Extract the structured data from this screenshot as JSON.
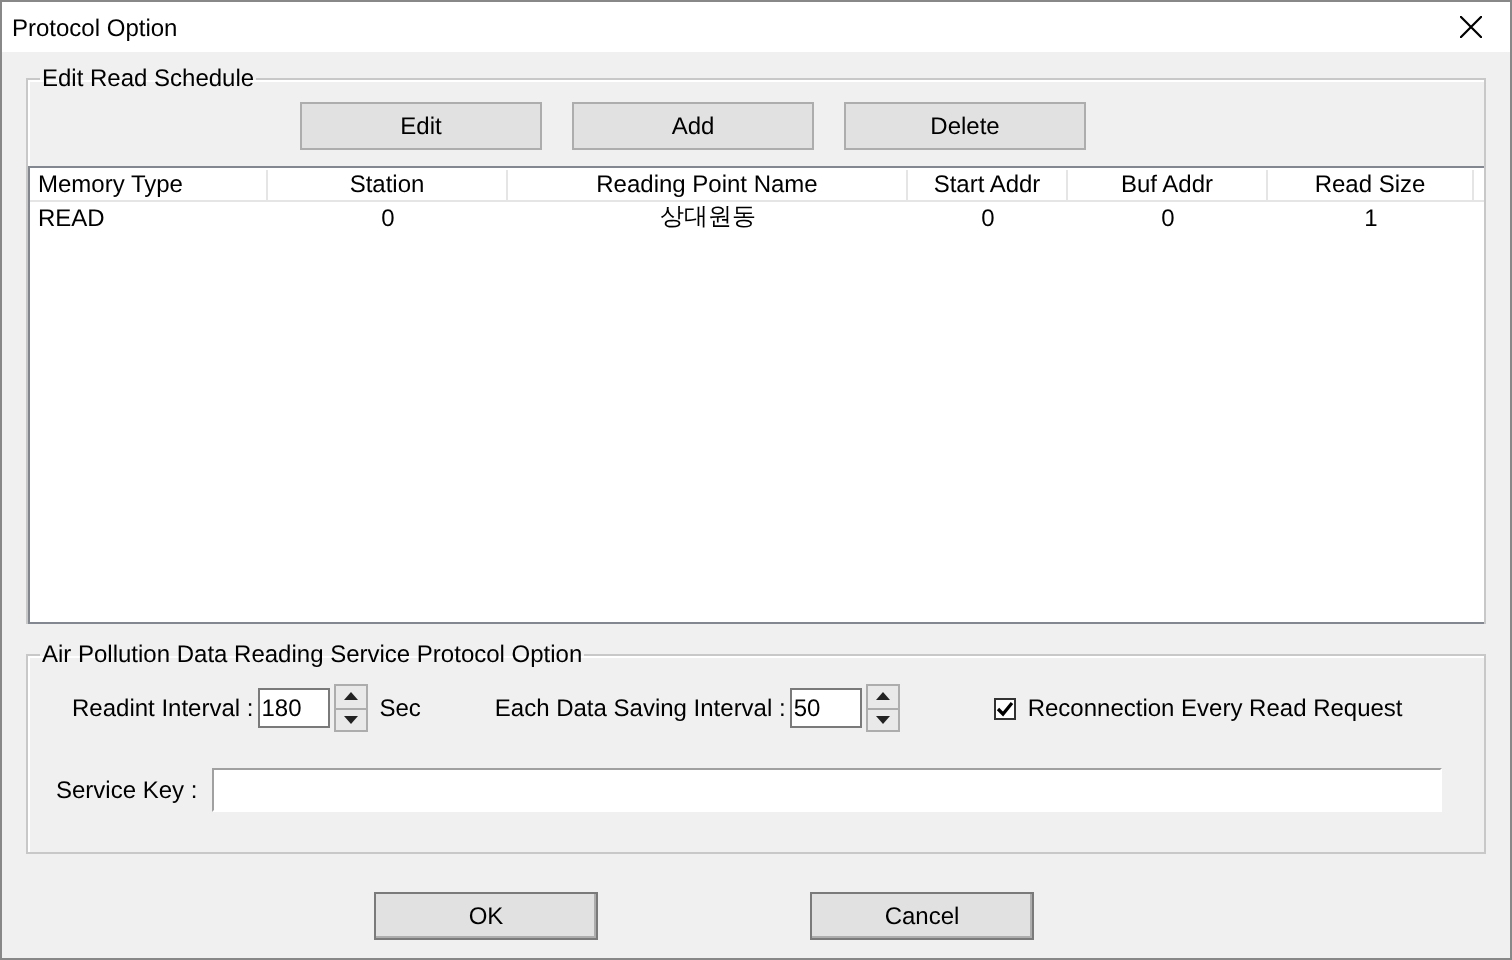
{
  "window": {
    "title": "Protocol Option"
  },
  "schedule": {
    "title": "Edit Read Schedule",
    "buttons": [
      "Edit",
      "Add",
      "Delete"
    ],
    "columns": [
      "Memory Type",
      "Station",
      "Reading Point Name",
      "Start Addr",
      "Buf Addr",
      "Read Size"
    ],
    "rows": [
      [
        "READ",
        "0",
        "상대원동",
        "0",
        "0",
        "1"
      ]
    ]
  },
  "service": {
    "title": "Air Pollution Data Reading Service Protocol Option",
    "read_interval": {
      "label": "Readint Interval :",
      "value": "180",
      "unit": "Sec"
    },
    "saving_interval": {
      "label": "Each Data Saving Interval :",
      "value": "50"
    },
    "reconnect": {
      "label": "Reconnection Every Read Request",
      "checked": true
    },
    "service_key": {
      "label": "Service Key :"
    }
  },
  "buttons": [
    "OK",
    "Cancel"
  ]
}
